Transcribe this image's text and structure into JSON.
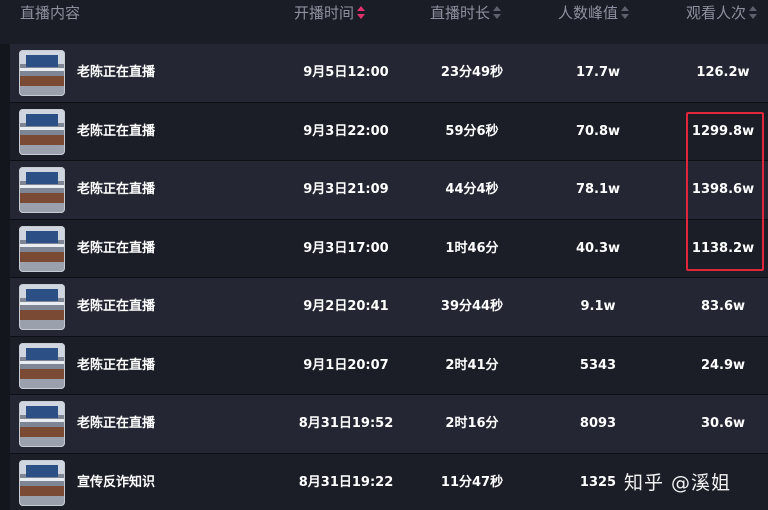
{
  "table": {
    "columns": [
      {
        "label": "直播内容",
        "sortable": false
      },
      {
        "label": "开播时间",
        "sortable": true,
        "active": true
      },
      {
        "label": "直播时长",
        "sortable": true
      },
      {
        "label": "人数峰值",
        "sortable": true
      },
      {
        "label": "观看人次",
        "sortable": true
      }
    ],
    "rows": [
      {
        "title": "老陈正在直播",
        "start_time": "9月5日12:00",
        "duration": "23分49秒",
        "peak": "17.7w",
        "views": "126.2w"
      },
      {
        "title": "老陈正在直播",
        "start_time": "9月3日22:00",
        "duration": "59分6秒",
        "peak": "70.8w",
        "views": "1299.8w"
      },
      {
        "title": "老陈正在直播",
        "start_time": "9月3日21:09",
        "duration": "44分4秒",
        "peak": "78.1w",
        "views": "1398.6w"
      },
      {
        "title": "老陈正在直播",
        "start_time": "9月3日17:00",
        "duration": "1时46分",
        "peak": "40.3w",
        "views": "1138.2w"
      },
      {
        "title": "老陈正在直播",
        "start_time": "9月2日20:41",
        "duration": "39分44秒",
        "peak": "9.1w",
        "views": "83.6w"
      },
      {
        "title": "老陈正在直播",
        "start_time": "9月1日20:07",
        "duration": "2时41分",
        "peak": "5343",
        "views": "24.9w"
      },
      {
        "title": "老陈正在直播",
        "start_time": "8月31日19:52",
        "duration": "2时16分",
        "peak": "8093",
        "views": "30.6w"
      },
      {
        "title": "宣传反诈知识",
        "start_time": "8月31日19:22",
        "duration": "11分47秒",
        "peak": "1325",
        "views": ""
      }
    ]
  },
  "watermark": "知乎 @溪姐",
  "colors": {
    "sort_active": "#e2316c",
    "highlight_border": "#e0263a"
  }
}
